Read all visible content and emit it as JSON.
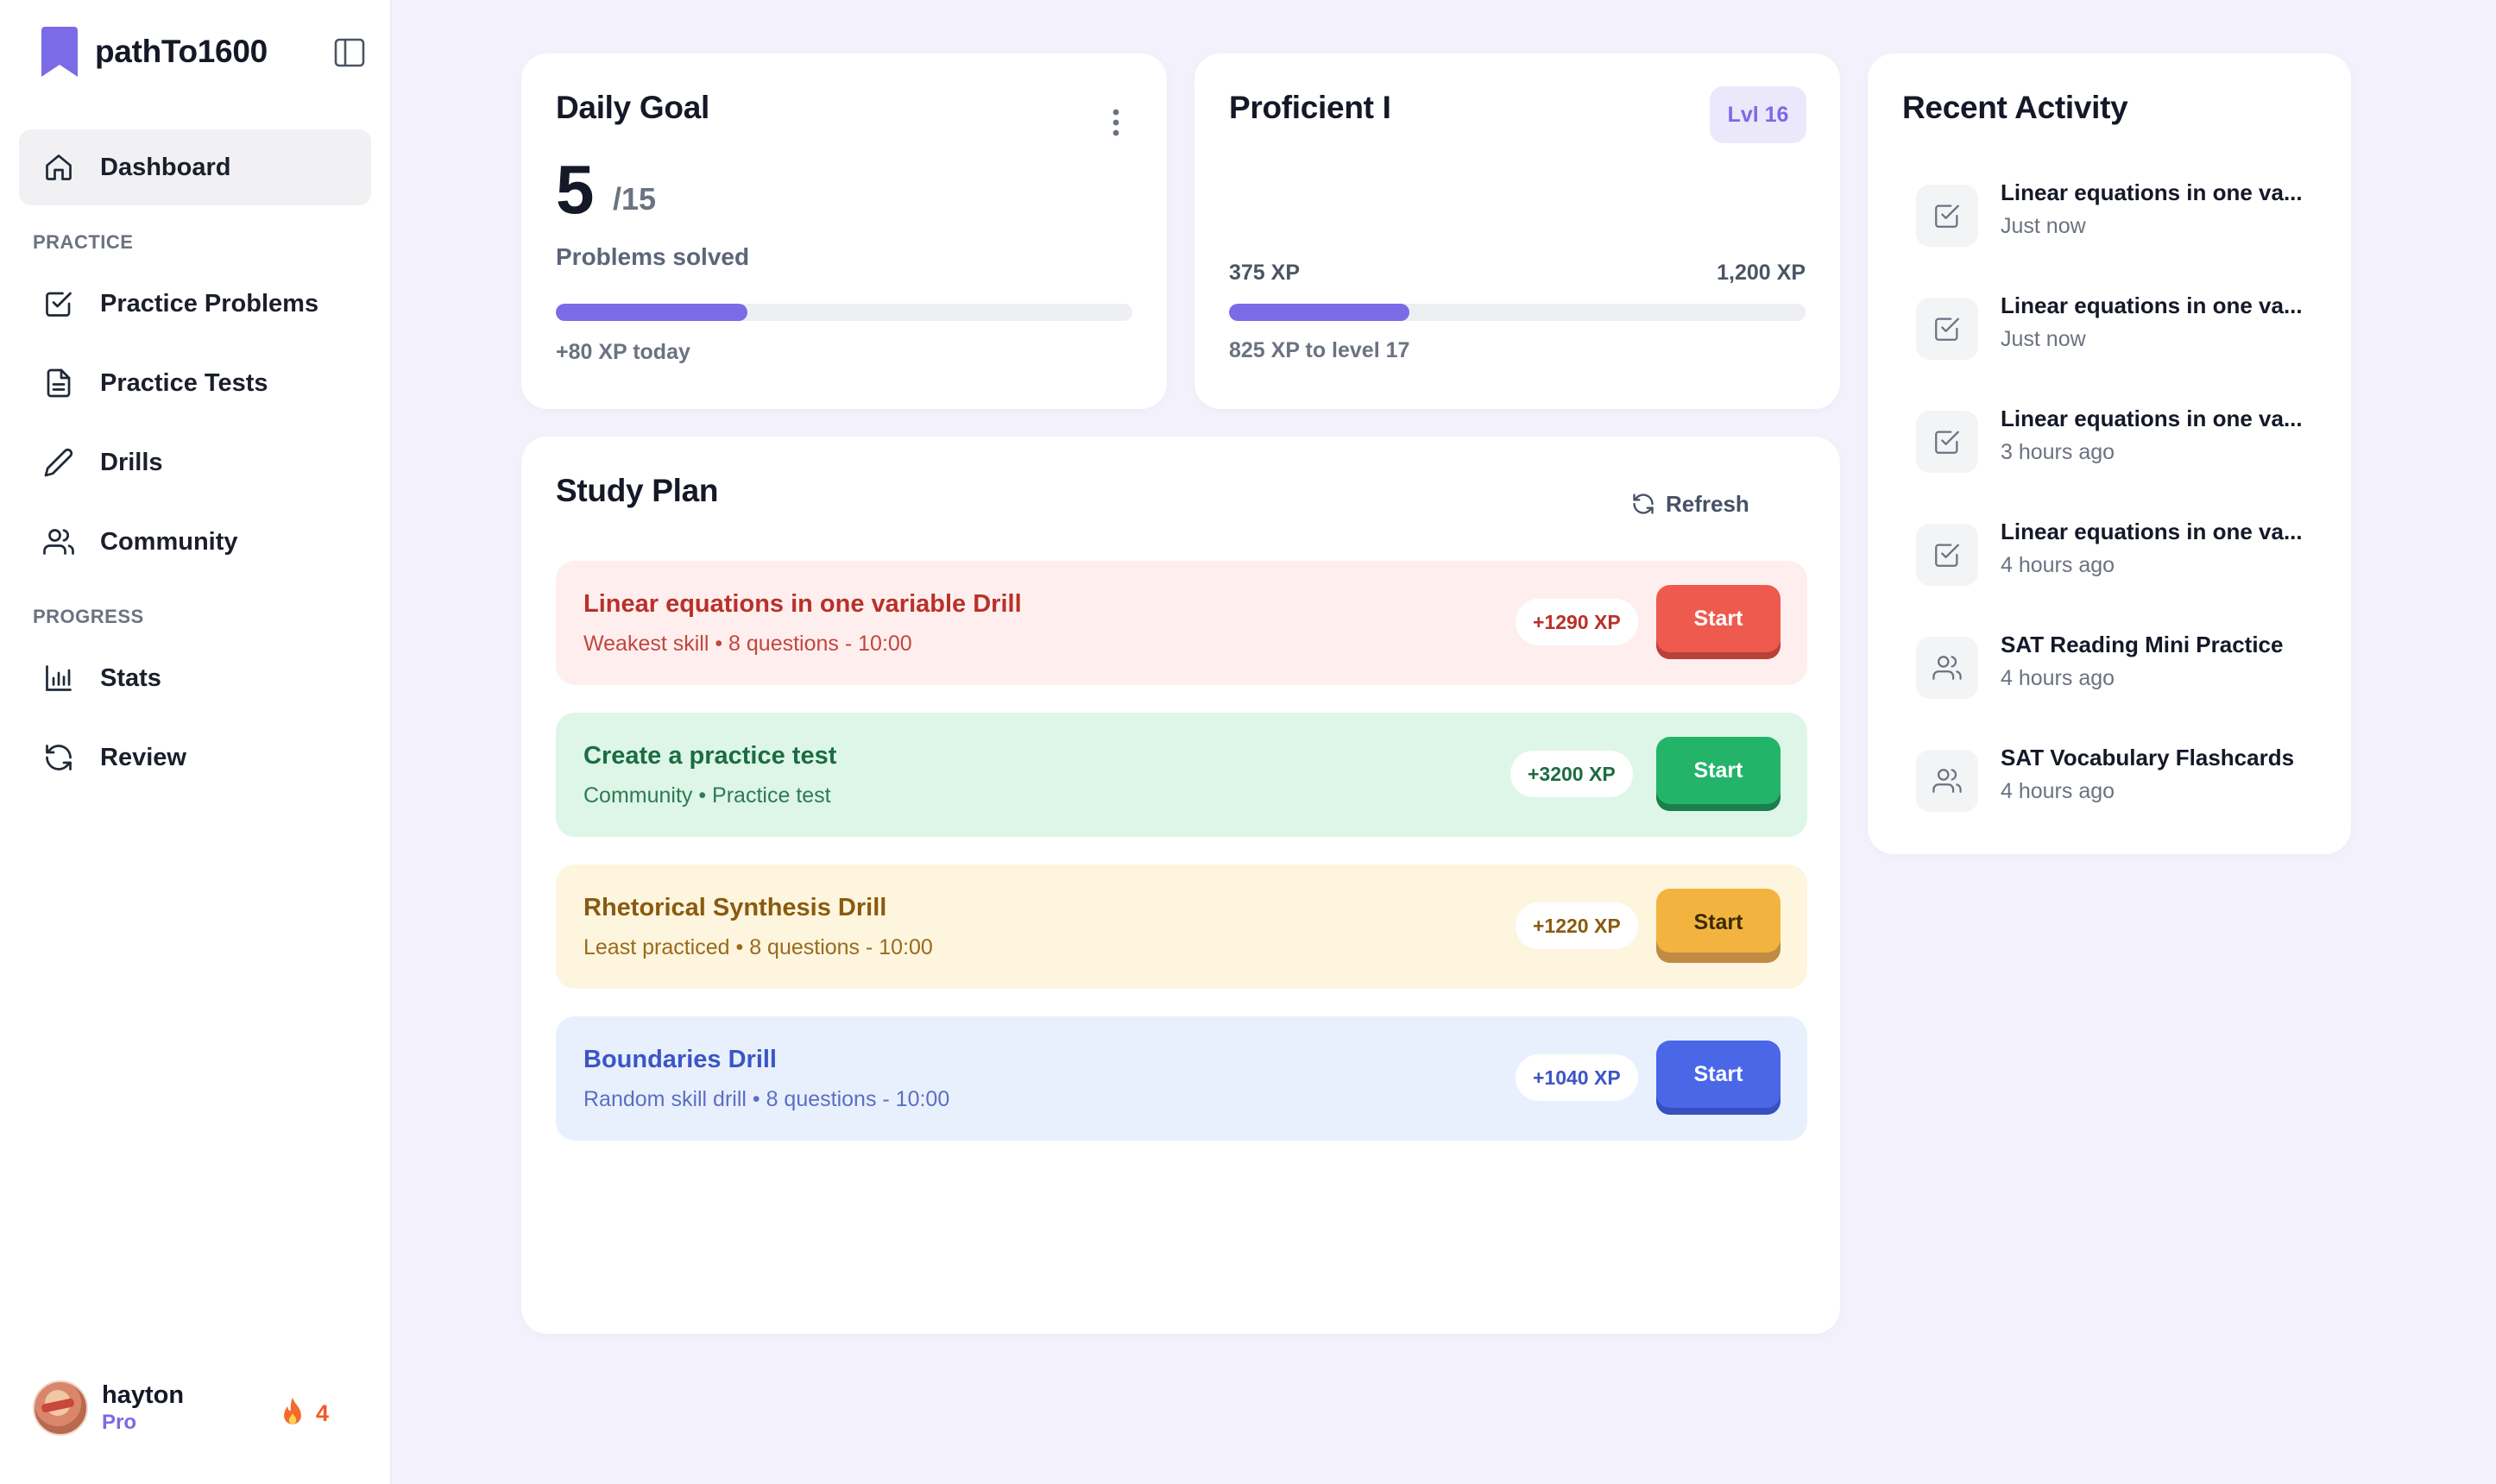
{
  "app": {
    "name": "pathTo1600"
  },
  "sidebar": {
    "dashboard": "Dashboard",
    "practice_section": "PRACTICE",
    "practice_items": [
      "Practice Problems",
      "Practice Tests",
      "Drills",
      "Community"
    ],
    "progress_section": "PROGRESS",
    "progress_items": [
      "Stats",
      "Review"
    ],
    "user": {
      "name": "hayton",
      "plan": "Pro",
      "streak": "4"
    }
  },
  "daily_goal": {
    "title": "Daily Goal",
    "solved": "5",
    "total": "/15",
    "label": "Problems solved",
    "progress": 0.333,
    "xp_today": "+80 XP today"
  },
  "level": {
    "title": "Proficient I",
    "badge": "Lvl 16",
    "current_xp": "375 XP",
    "next_xp": "1,200 XP",
    "progress": 0.3125,
    "to_next": "825 XP to level 17"
  },
  "study_plan": {
    "title": "Study Plan",
    "refresh": "Refresh",
    "items": [
      {
        "title": "Linear equations in one variable Drill",
        "subtitle": "Weakest skill • 8 questions - 10:00",
        "xp": "+1290 XP",
        "action": "Start"
      },
      {
        "title": "Create a practice test",
        "subtitle": "Community • Practice test",
        "xp": "+3200 XP",
        "action": "Start"
      },
      {
        "title": "Rhetorical Synthesis Drill",
        "subtitle": "Least practiced • 8 questions - 10:00",
        "xp": "+1220 XP",
        "action": "Start"
      },
      {
        "title": "Boundaries Drill",
        "subtitle": "Random skill drill • 8 questions - 10:00",
        "xp": "+1040 XP",
        "action": "Start"
      }
    ]
  },
  "recent_activity": {
    "title": "Recent Activity",
    "items": [
      {
        "title": "Linear equations in one va...",
        "time": "Just now",
        "icon": "checkbox-icon"
      },
      {
        "title": "Linear equations in one va...",
        "time": "Just now",
        "icon": "checkbox-icon"
      },
      {
        "title": "Linear equations in one va...",
        "time": "3 hours ago",
        "icon": "checkbox-icon"
      },
      {
        "title": "Linear equations in one va...",
        "time": "4 hours ago",
        "icon": "checkbox-icon"
      },
      {
        "title": "SAT Reading Mini Practice",
        "time": "4 hours ago",
        "icon": "users-icon"
      },
      {
        "title": "SAT Vocabulary Flashcards",
        "time": "4 hours ago",
        "icon": "users-icon"
      }
    ]
  },
  "colors": {
    "accent": "#7b6be6",
    "red": "#ef5a4e",
    "green": "#23b46a",
    "amber": "#f3b43f",
    "blue": "#4a67e8"
  }
}
